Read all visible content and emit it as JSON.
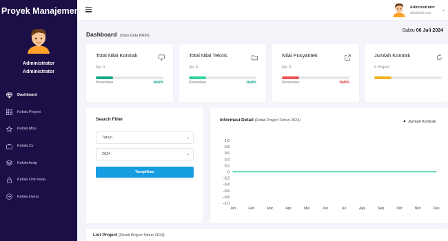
{
  "app": {
    "brand": "Proyek Manajemen"
  },
  "sidebar": {
    "profile_name": "Administrator",
    "profile_role": "Administrator",
    "items": [
      {
        "label": "Dashboard",
        "icon": "diamond-icon",
        "active": true
      },
      {
        "label": "Kelola Project",
        "icon": "grid-icon",
        "active": false
      },
      {
        "label": "Kelola Mou",
        "icon": "star-icon",
        "active": false
      },
      {
        "label": "Kelola Cv",
        "icon": "briefcase-icon",
        "active": false
      },
      {
        "label": "Kelola Arsip",
        "icon": "layers-icon",
        "active": false
      },
      {
        "label": "Kelola Unit Kerja",
        "icon": "lock-icon",
        "active": false
      },
      {
        "label": "Kelola Users",
        "icon": "logout-icon",
        "active": false
      }
    ]
  },
  "topbar": {
    "user_name": "Administrator",
    "user_email": "whiz@whiz.com"
  },
  "header": {
    "title": "Dashboard",
    "subtitle": "(Satu Data BRIN)",
    "date_day": "Sabtu",
    "date_value": "06 Juli 2024"
  },
  "stats": [
    {
      "title": "Total Nilai Kontrak",
      "value": "Rp. 0",
      "label": "Persentase",
      "pct": "NaN%",
      "color": "#13a88b",
      "pct_color": "#13a88b",
      "icon": "monitor-icon"
    },
    {
      "title": "Total Nilai Teknis",
      "value": "Rp. 0",
      "label": "Persentase",
      "pct": "NaN%",
      "color": "#2fd6a4",
      "pct_color": "#13a88b",
      "icon": "folder-icon"
    },
    {
      "title": "Nilai Pusyantek",
      "value": "Rp. 0",
      "label": "Persentase",
      "pct": "NaN%",
      "color": "#f05252",
      "pct_color": "#e03a3a",
      "icon": "external-icon"
    },
    {
      "title": "Jumlah Kontrak",
      "value": "0 Project",
      "label": "",
      "pct": "",
      "color": "#f2b21b",
      "pct_color": "#f2b21b",
      "icon": "refresh-icon"
    }
  ],
  "filter": {
    "title": "Search Filter",
    "select_type": "Tahun",
    "select_year": "2024",
    "button": "Tampilkan"
  },
  "chart": {
    "title": "Informasi Detail",
    "subtitle": "(Detail Project Tahun 2024)"
  },
  "chart_data": {
    "type": "line",
    "title": "Informasi Detail (Detail Project Tahun 2024)",
    "categories": [
      "Jan",
      "Feb",
      "Mar",
      "Apr",
      "Mei",
      "Jun",
      "Jul",
      "Agu",
      "Sep",
      "Okt",
      "Nov",
      "Des"
    ],
    "series": [
      {
        "name": "Jumlah Kontrak",
        "values": [
          0,
          0,
          0,
          0,
          0,
          0,
          0,
          0,
          0,
          0,
          0,
          0
        ],
        "color": "#37d1a6"
      }
    ],
    "yticks": [
      "1.0",
      "0.8",
      "0.6",
      "0.4",
      "0.2",
      "0",
      "−0.2",
      "−0.4",
      "−0.6",
      "−0.8",
      "−1.0"
    ],
    "ylim": [
      -1.0,
      1.0
    ],
    "legend_position": "top-right",
    "grid": false
  },
  "list": {
    "title": "List Project",
    "subtitle": "(Detail Project Tahun 2024)"
  }
}
